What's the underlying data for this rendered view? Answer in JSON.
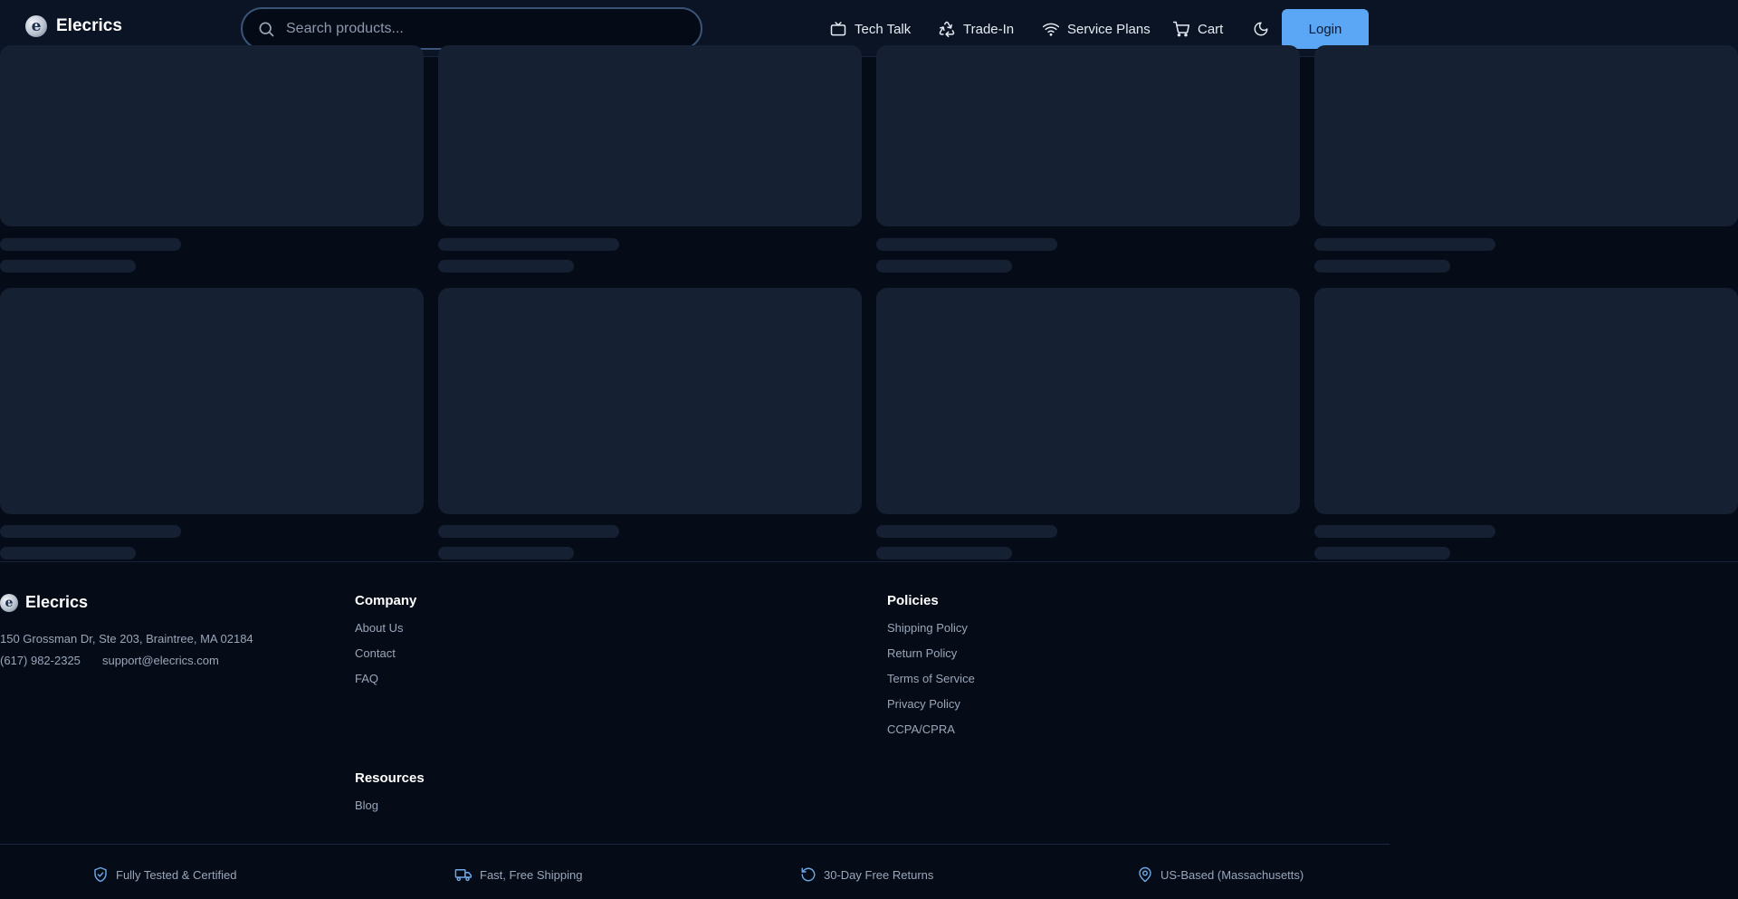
{
  "brand": {
    "name": "Elecrics",
    "logo_letter": "e"
  },
  "search": {
    "placeholder": "Search products..."
  },
  "nav": {
    "tech_talk": "Tech Talk",
    "trade_in": "Trade-In",
    "service_plans": "Service Plans",
    "cart": "Cart",
    "login": "Login"
  },
  "footer": {
    "brand_name": "Elecrics",
    "address": "150 Grossman Dr, Ste 203, Braintree, MA 02184",
    "phone": "(617) 982-2325",
    "email": "support@elecrics.com",
    "company": {
      "heading": "Company",
      "links": [
        "About Us",
        "Contact",
        "FAQ"
      ]
    },
    "policies": {
      "heading": "Policies",
      "links": [
        "Shipping Policy",
        "Return Policy",
        "Terms of Service",
        "Privacy Policy",
        "CCPA/CPRA"
      ]
    },
    "resources": {
      "heading": "Resources",
      "links": [
        "Blog"
      ]
    }
  },
  "badges": [
    "Fully Tested & Certified",
    "Fast, Free Shipping",
    "30-Day Free Returns",
    "US-Based (Massachusetts)"
  ],
  "colors": {
    "accent": "#5ba6f5",
    "background": "#050c18",
    "header": "#0a1424",
    "skeleton": "#162033",
    "icon_accent": "#6ea8e8"
  },
  "icons": {
    "search": "search-icon",
    "tech_talk": "tv-icon",
    "trade_in": "recycle-icon",
    "service_plans": "wifi-icon",
    "cart": "cart-icon",
    "theme": "moon-icon",
    "certified": "shield-check-icon",
    "shipping": "truck-icon",
    "returns": "rotate-ccw-icon",
    "location": "map-pin-icon"
  }
}
